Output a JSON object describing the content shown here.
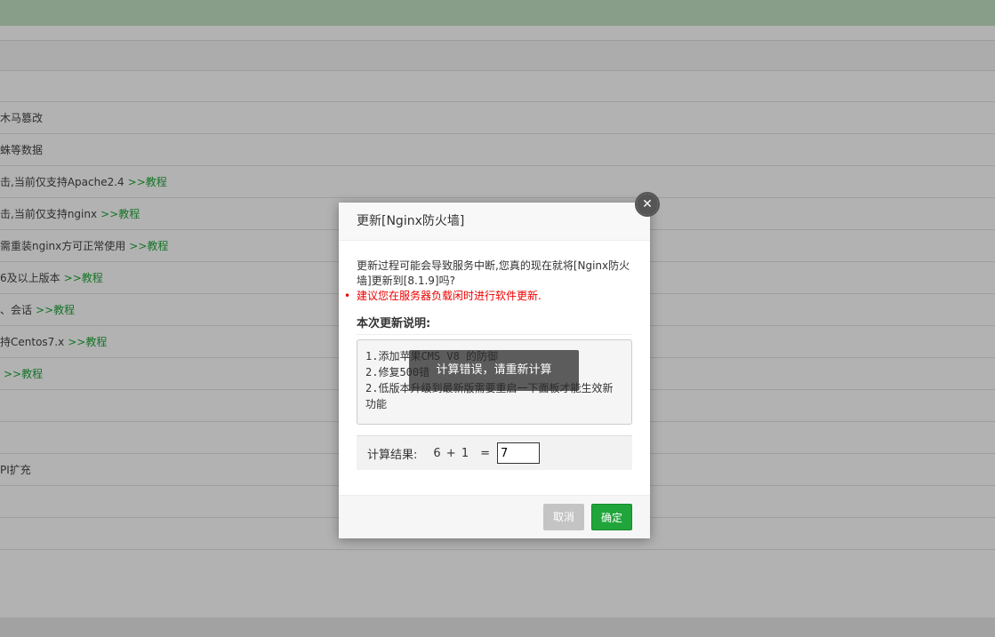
{
  "background": {
    "rows": [
      {
        "text": "",
        "link": ""
      },
      {
        "text": "木马篡改",
        "link": ""
      },
      {
        "text": "蛛等数据",
        "link": ""
      },
      {
        "text": "击,当前仅支持Apache2.4",
        "link": ">>教程"
      },
      {
        "text": "击,当前仅支持nginx",
        "link": ">>教程"
      },
      {
        "text": "需重装nginx方可正常使用",
        "link": ">>教程"
      },
      {
        "text": "6及以上版本",
        "link": ">>教程"
      },
      {
        "text": "、会话",
        "link": ">>教程"
      },
      {
        "text": "持Centos7.x",
        "link": ">>教程"
      },
      {
        "text": "",
        "link": ">>教程"
      },
      {
        "text": "",
        "link": ""
      },
      {
        "text": "",
        "link": ""
      },
      {
        "text": "PI扩充",
        "link": ""
      },
      {
        "text": "",
        "link": ""
      },
      {
        "text": "",
        "link": ""
      }
    ]
  },
  "dialog": {
    "title": "更新[Nginx防火墙]",
    "message": "更新过程可能会导致服务中断,您真的现在就将[Nginx防火墙]更新到[8.1.9]吗?",
    "warning": "建议您在服务器负载闲时进行软件更新.",
    "notes_title": "本次更新说明:",
    "notes": [
      "1.添加苹果CMS V8 的防御",
      "2.修复500错",
      "2.低版本升级到最新版需要重启一下面板才能生效新功能"
    ],
    "calc_label": "计算结果:",
    "calc_expr": "6 + 1",
    "calc_eq": "=",
    "calc_value": "7",
    "cancel_label": "取消",
    "ok_label": "确定"
  },
  "toast": "计算错误，请重新计算",
  "colors": {
    "accent_green": "#20a53a",
    "warning_red": "#ee0000"
  }
}
